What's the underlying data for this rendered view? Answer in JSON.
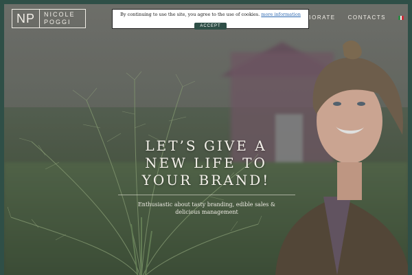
{
  "header": {
    "logo_initials": "NP",
    "logo_line1": "NICOLE",
    "logo_line2": "POGGI",
    "nav": {
      "collaborate_label": "LABORATE",
      "contacts_label": "CONTACTS"
    },
    "language_icon": "italian-flag-icon"
  },
  "cookie_banner": {
    "text": "By continuing to use the site, you agree to the use of cookies.",
    "link_label": "more information",
    "accept_label": "ACCEPT"
  },
  "hero": {
    "headline_line1": "LET’S GIVE A",
    "headline_line2": "NEW LIFE TO",
    "headline_line3": "YOUR BRAND!",
    "subline": "Enthusiastic about tasty branding, edible sales & delicious management"
  },
  "colors": {
    "frame": "#2f4f47",
    "text_light": "#f2efe8",
    "link": "#2a66b0"
  }
}
